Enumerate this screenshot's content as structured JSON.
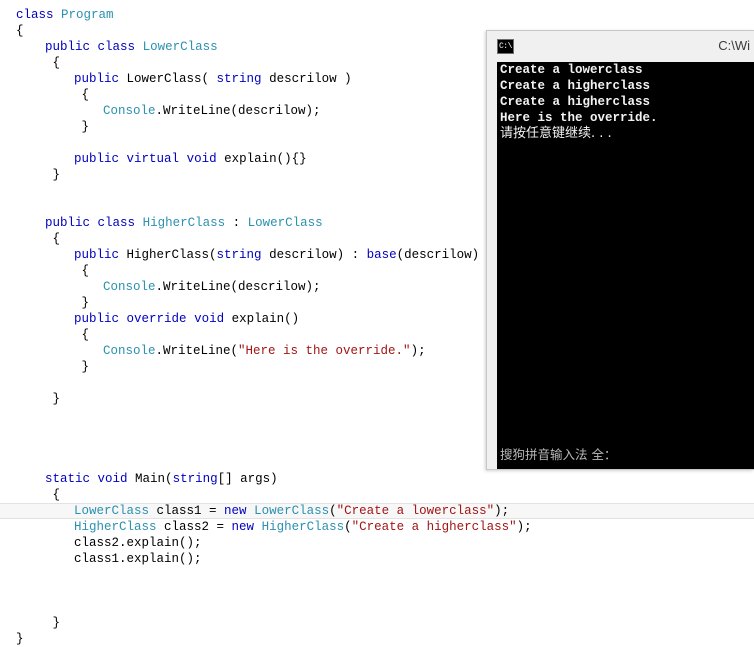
{
  "editor": {
    "name": "code-editor",
    "language": "csharp",
    "colors": {
      "background": "#ffffff",
      "plain": "#000000",
      "keyword": "#0000c0",
      "type": "#2b91af",
      "string": "#a31515",
      "current_line_background": "#f7f7f7",
      "current_line_border": "#e2e2e2"
    },
    "current_line_index": 31,
    "lines": [
      {
        "indent": 0,
        "tokens": [
          {
            "t": "kw",
            "v": "class"
          },
          {
            "t": "pl",
            "v": " "
          },
          {
            "t": "type",
            "v": "Program"
          }
        ]
      },
      {
        "indent": 0,
        "tokens": [
          {
            "t": "pl",
            "v": "{"
          }
        ]
      },
      {
        "indent": 1,
        "tokens": [
          {
            "t": "kw",
            "v": "public"
          },
          {
            "t": "pl",
            "v": " "
          },
          {
            "t": "kw",
            "v": "class"
          },
          {
            "t": "pl",
            "v": " "
          },
          {
            "t": "type",
            "v": "LowerClass"
          }
        ]
      },
      {
        "indent": 1,
        "tokens": [
          {
            "t": "pl",
            "v": " {"
          }
        ]
      },
      {
        "indent": 2,
        "tokens": [
          {
            "t": "kw",
            "v": "public"
          },
          {
            "t": "pl",
            "v": " LowerClass( "
          },
          {
            "t": "kw",
            "v": "string"
          },
          {
            "t": "pl",
            "v": " descrilow )"
          }
        ]
      },
      {
        "indent": 2,
        "tokens": [
          {
            "t": "pl",
            "v": " {"
          }
        ]
      },
      {
        "indent": 3,
        "tokens": [
          {
            "t": "type",
            "v": "Console"
          },
          {
            "t": "pl",
            "v": ".WriteLine(descrilow);"
          }
        ]
      },
      {
        "indent": 2,
        "tokens": [
          {
            "t": "pl",
            "v": " }"
          }
        ]
      },
      {
        "indent": 0,
        "tokens": []
      },
      {
        "indent": 2,
        "tokens": [
          {
            "t": "kw",
            "v": "public"
          },
          {
            "t": "pl",
            "v": " "
          },
          {
            "t": "kw",
            "v": "virtual"
          },
          {
            "t": "pl",
            "v": " "
          },
          {
            "t": "kw",
            "v": "void"
          },
          {
            "t": "pl",
            "v": " explain(){}"
          }
        ]
      },
      {
        "indent": 1,
        "tokens": [
          {
            "t": "pl",
            "v": " }"
          }
        ]
      },
      {
        "indent": 0,
        "tokens": []
      },
      {
        "indent": 0,
        "tokens": []
      },
      {
        "indent": 1,
        "tokens": [
          {
            "t": "kw",
            "v": "public"
          },
          {
            "t": "pl",
            "v": " "
          },
          {
            "t": "kw",
            "v": "class"
          },
          {
            "t": "pl",
            "v": " "
          },
          {
            "t": "type",
            "v": "HigherClass"
          },
          {
            "t": "pl",
            "v": " : "
          },
          {
            "t": "type",
            "v": "LowerClass"
          }
        ]
      },
      {
        "indent": 1,
        "tokens": [
          {
            "t": "pl",
            "v": " {"
          }
        ]
      },
      {
        "indent": 2,
        "tokens": [
          {
            "t": "kw",
            "v": "public"
          },
          {
            "t": "pl",
            "v": " HigherClass("
          },
          {
            "t": "kw",
            "v": "string"
          },
          {
            "t": "pl",
            "v": " descrilow) : "
          },
          {
            "t": "kw",
            "v": "base"
          },
          {
            "t": "pl",
            "v": "(descrilow)"
          }
        ]
      },
      {
        "indent": 2,
        "tokens": [
          {
            "t": "pl",
            "v": " {"
          }
        ]
      },
      {
        "indent": 3,
        "tokens": [
          {
            "t": "type",
            "v": "Console"
          },
          {
            "t": "pl",
            "v": ".WriteLine(descrilow);"
          }
        ]
      },
      {
        "indent": 2,
        "tokens": [
          {
            "t": "pl",
            "v": " }"
          }
        ]
      },
      {
        "indent": 2,
        "tokens": [
          {
            "t": "kw",
            "v": "public"
          },
          {
            "t": "pl",
            "v": " "
          },
          {
            "t": "kw",
            "v": "override"
          },
          {
            "t": "pl",
            "v": " "
          },
          {
            "t": "kw",
            "v": "void"
          },
          {
            "t": "pl",
            "v": " explain()"
          }
        ]
      },
      {
        "indent": 2,
        "tokens": [
          {
            "t": "pl",
            "v": " {"
          }
        ]
      },
      {
        "indent": 3,
        "tokens": [
          {
            "t": "type",
            "v": "Console"
          },
          {
            "t": "pl",
            "v": ".WriteLine("
          },
          {
            "t": "str",
            "v": "\"Here is the override.\""
          },
          {
            "t": "pl",
            "v": ");"
          }
        ]
      },
      {
        "indent": 2,
        "tokens": [
          {
            "t": "pl",
            "v": " }"
          }
        ]
      },
      {
        "indent": 0,
        "tokens": []
      },
      {
        "indent": 1,
        "tokens": [
          {
            "t": "pl",
            "v": " }"
          }
        ]
      },
      {
        "indent": 0,
        "tokens": []
      },
      {
        "indent": 0,
        "tokens": []
      },
      {
        "indent": 0,
        "tokens": []
      },
      {
        "indent": 0,
        "tokens": []
      },
      {
        "indent": 1,
        "tokens": [
          {
            "t": "kw",
            "v": "static"
          },
          {
            "t": "pl",
            "v": " "
          },
          {
            "t": "kw",
            "v": "void"
          },
          {
            "t": "pl",
            "v": " Main("
          },
          {
            "t": "kw",
            "v": "string"
          },
          {
            "t": "pl",
            "v": "[] args)"
          }
        ]
      },
      {
        "indent": 1,
        "tokens": [
          {
            "t": "pl",
            "v": " {"
          }
        ]
      },
      {
        "indent": 2,
        "tokens": [
          {
            "t": "type",
            "v": "LowerClass"
          },
          {
            "t": "pl",
            "v": " class1 = "
          },
          {
            "t": "kw",
            "v": "new"
          },
          {
            "t": "pl",
            "v": " "
          },
          {
            "t": "type",
            "v": "LowerClass"
          },
          {
            "t": "pl",
            "v": "("
          },
          {
            "t": "str",
            "v": "\"Create a lowerclass\""
          },
          {
            "t": "pl",
            "v": ");"
          }
        ]
      },
      {
        "indent": 2,
        "tokens": [
          {
            "t": "type",
            "v": "HigherClass"
          },
          {
            "t": "pl",
            "v": " class2 = "
          },
          {
            "t": "kw",
            "v": "new"
          },
          {
            "t": "pl",
            "v": " "
          },
          {
            "t": "type",
            "v": "HigherClass"
          },
          {
            "t": "pl",
            "v": "("
          },
          {
            "t": "str",
            "v": "\"Create a higherclass\""
          },
          {
            "t": "pl",
            "v": ");"
          }
        ]
      },
      {
        "indent": 2,
        "tokens": [
          {
            "t": "pl",
            "v": "class2.explain();"
          }
        ]
      },
      {
        "indent": 2,
        "tokens": [
          {
            "t": "pl",
            "v": "class1.explain();"
          }
        ]
      },
      {
        "indent": 0,
        "tokens": []
      },
      {
        "indent": 0,
        "tokens": []
      },
      {
        "indent": 0,
        "tokens": []
      },
      {
        "indent": 1,
        "tokens": [
          {
            "t": "pl",
            "v": " }"
          }
        ]
      },
      {
        "indent": 0,
        "tokens": [
          {
            "t": "pl",
            "v": "}"
          }
        ]
      }
    ]
  },
  "console_window": {
    "icon": "console-icon",
    "icon_glyph": "C:\\",
    "title": "C:\\Wi",
    "colors": {
      "titlebar": "#f0f0f0",
      "screen": "#000000",
      "text": "#f2f2f2"
    },
    "output_lines": [
      "Create a lowerclass",
      "Create a higherclass",
      "Create a higherclass",
      "Here is the override."
    ],
    "prompt_line": "请按任意键继续. . .",
    "ime_status": "搜狗拼音输入法 全："
  }
}
